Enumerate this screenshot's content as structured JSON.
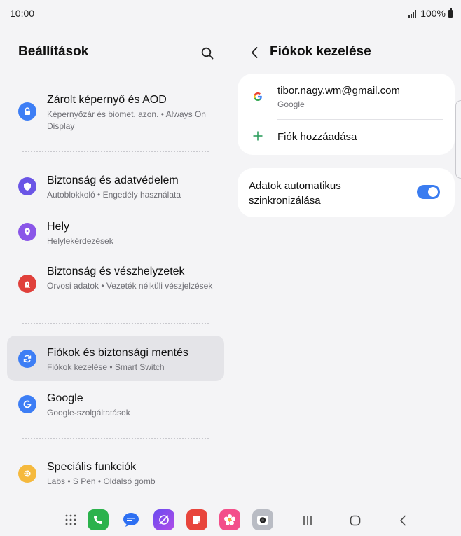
{
  "status_bar": {
    "time": "10:00",
    "battery": "100%"
  },
  "left_pane": {
    "title": "Beállítások",
    "items": [
      {
        "title": "Zárolt képernyő és AOD",
        "subtitle": "Képernyőzár és biomet. azon.  •  Always On Display",
        "icon": "lock-icon",
        "color": "#3d7ef5"
      },
      {
        "title": "Biztonság és adatvédelem",
        "subtitle": "Autoblokkoló  •  Engedély használata",
        "icon": "shield-icon",
        "color": "#6a55e6"
      },
      {
        "title": "Hely",
        "subtitle": "Helylekérdezések",
        "icon": "location-pin-icon",
        "color": "#8a56e8"
      },
      {
        "title": "Biztonság és vészhelyzetek",
        "subtitle": "Orvosi adatok  •  Vezeték nélküli vészjelzések",
        "icon": "emergency-icon",
        "color": "#e0403b"
      },
      {
        "title": "Fiókok és biztonsági mentés",
        "subtitle": "Fiókok kezelése  •  Smart Switch",
        "icon": "sync-icon",
        "color": "#3d7ef5",
        "selected": true
      },
      {
        "title": "Google",
        "subtitle": "Google-szolgáltatások",
        "icon": "google-g-icon",
        "color": "#3d7ef5"
      },
      {
        "title": "Speciális funkciók",
        "subtitle": "Labs  •  S Pen  •  Oldalsó gomb",
        "icon": "gear-icon",
        "color": "#f5b93d"
      }
    ]
  },
  "right_pane": {
    "title": "Fiókok kezelése",
    "account": {
      "email": "tibor.nagy.wm@gmail.com",
      "type": "Google"
    },
    "add_account_label": "Fiók hozzáadása",
    "auto_sync": {
      "label": "Adatok automatikus szinkronizálása",
      "enabled": true
    }
  },
  "taskbar": {
    "apps": [
      "apps-grid-icon",
      "phone-icon",
      "messages-icon",
      "internet-icon",
      "notes-icon",
      "gallery-icon",
      "camera-icon"
    ],
    "nav": [
      "recents-icon",
      "home-icon",
      "back-icon"
    ]
  }
}
